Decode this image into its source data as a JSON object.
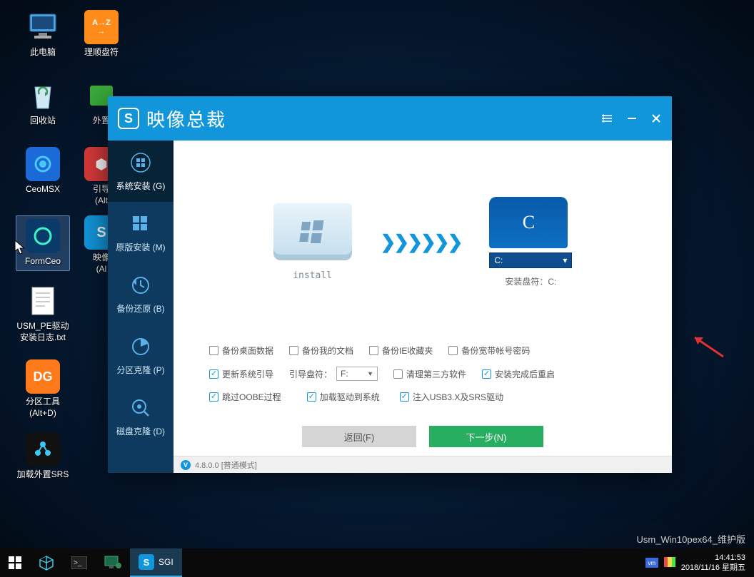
{
  "desktop": {
    "icons": [
      {
        "label": "此电脑"
      },
      {
        "label": "理顺盘符"
      },
      {
        "label": "回收站"
      },
      {
        "label": "外置"
      },
      {
        "label": "CeoMSX"
      },
      {
        "label": "引导\n(Alt"
      },
      {
        "label": "FormCeo"
      },
      {
        "label": "映像\n(Al"
      },
      {
        "label": "USM_PE驱动\n安装日志.txt"
      },
      {
        "label": "分区工具\n(Alt+D)"
      },
      {
        "label": "加载外置SRS"
      }
    ]
  },
  "app": {
    "title": "映像总裁",
    "sidebar": [
      {
        "label": "系统安装 (G)"
      },
      {
        "label": "原版安装 (M)"
      },
      {
        "label": "备份还原 (B)"
      },
      {
        "label": "分区克隆 (P)"
      },
      {
        "label": "磁盘克隆 (D)"
      }
    ],
    "install_label": "install",
    "drive_letter": "C",
    "drive_select_value": "C:",
    "target_label": "安装盘符：C:",
    "options": {
      "row1": [
        "备份桌面数据",
        "备份我的文档",
        "备份IE收藏夹",
        "备份宽带帐号密码"
      ],
      "row2_chk1": "更新系统引导",
      "row2_boot_label": "引导盘符：",
      "row2_boot_value": "F:",
      "row2_chk2": "清理第三方软件",
      "row2_chk3": "安装完成后重启",
      "row3": [
        "跳过OOBE过程",
        "加载驱动到系统",
        "注入USB3.X及SRS驱动"
      ]
    },
    "btn_back": "返回(F)",
    "btn_next": "下一步(N)",
    "footer_version": "4.8.0.0 [普通模式]"
  },
  "taskbar": {
    "app_label": "SGI"
  },
  "watermark": "Usm_Win10pex64_维护版",
  "systray": {
    "time": "14:41:53",
    "date": "2018/11/16 星期五"
  }
}
